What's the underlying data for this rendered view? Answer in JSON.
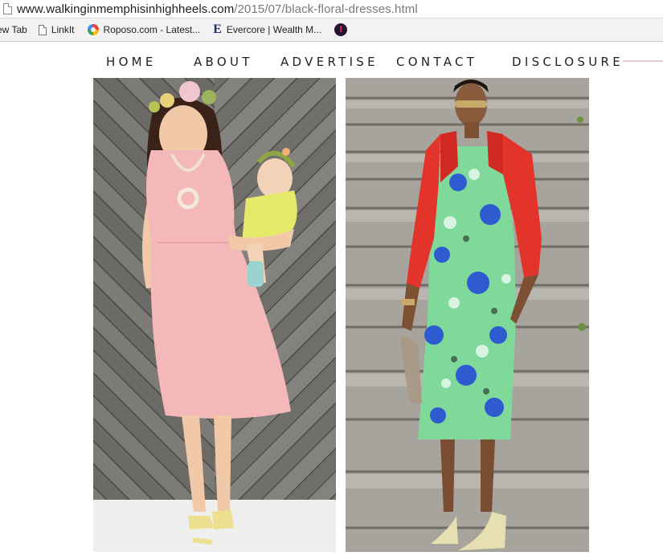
{
  "browser": {
    "url_host": "www.walkinginmemphisinhighheels.com",
    "url_path": "/2015/07/black-floral-dresses.html"
  },
  "bookmarks": [
    {
      "label": "ew Tab",
      "icon": "none"
    },
    {
      "label": "LinkIt",
      "icon": "page-icon"
    },
    {
      "label": "Roposo.com - Latest...",
      "icon": "roposo-logo-icon"
    },
    {
      "label": "Evercore | Wealth M...",
      "icon": "evercore-logo-icon"
    },
    {
      "label": "",
      "icon": "site-favicon-icon"
    }
  ],
  "nav": {
    "home": "HOME",
    "about": "ABOUT",
    "advertise": "ADVERTISE",
    "contact": "CONTACT",
    "disclosure": "DISCLOSURE"
  },
  "colors": {
    "nav_accent_line": "#e8ccd4",
    "left_dress": "#f5b8b8",
    "right_jacket": "#e3342b",
    "right_dress": "#7fd99a"
  }
}
